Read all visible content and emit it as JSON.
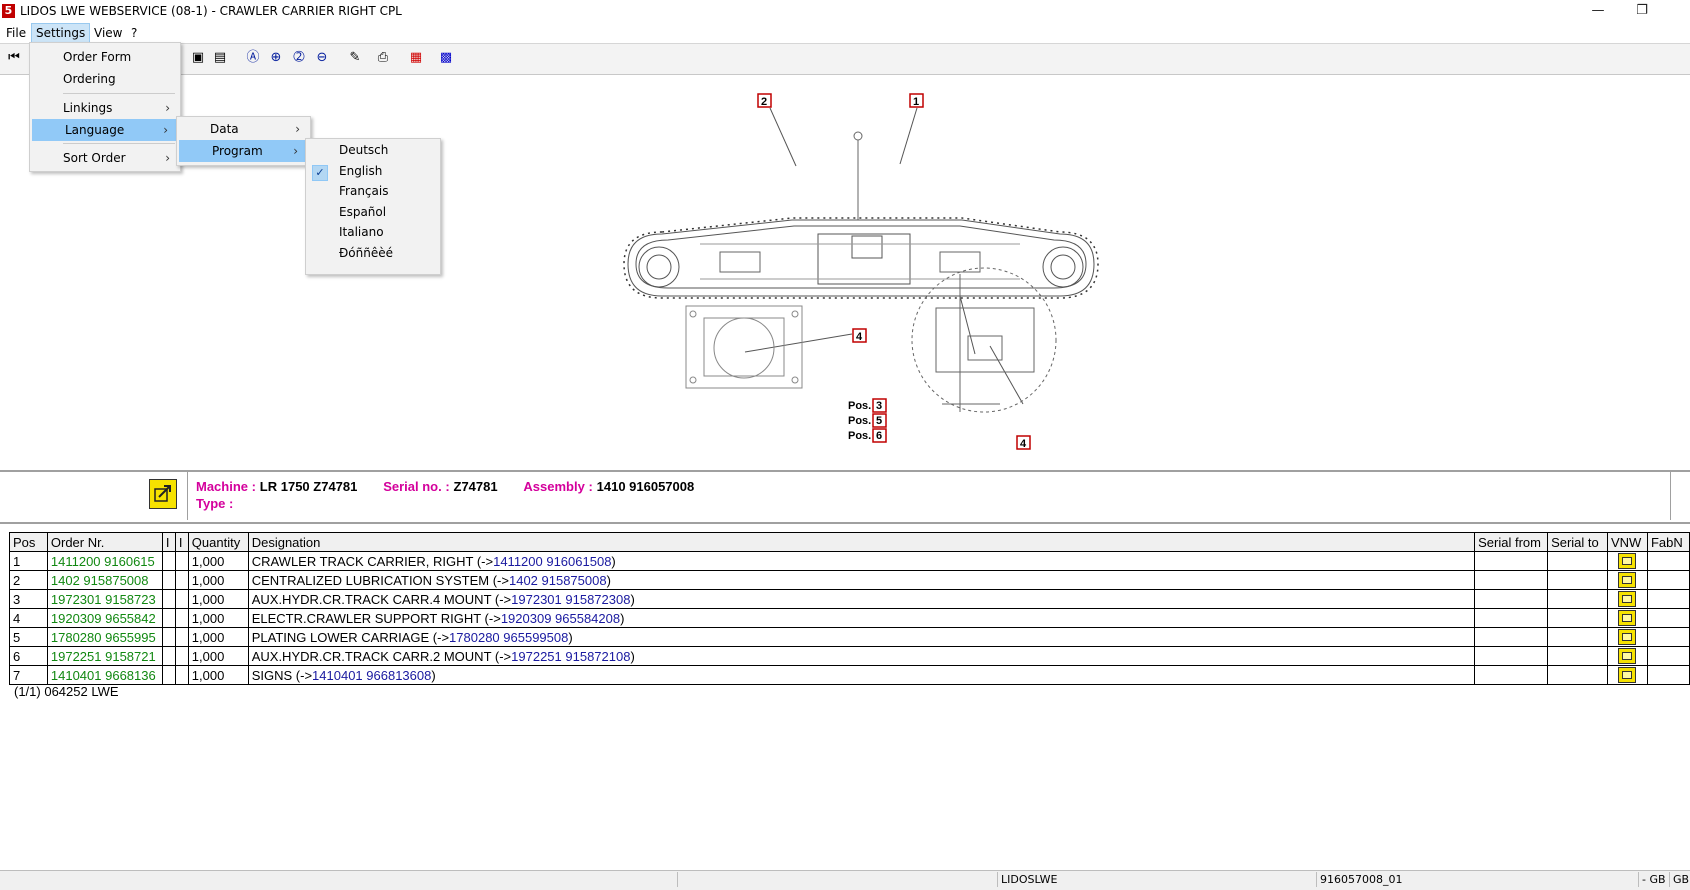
{
  "window": {
    "title": "LIDOS LWE WEBSERVICE (08-1) - CRAWLER CARRIER RIGHT CPL",
    "icon_letter": "5",
    "minimize_icon": "minimize-icon",
    "restore_icon": "restore-icon"
  },
  "menubar": {
    "file": "File",
    "settings": "Settings",
    "view": "View",
    "help": "?"
  },
  "settings_menu": {
    "order_form": "Order Form",
    "ordering": "Ordering",
    "linkings": "Linkings",
    "language": "Language",
    "sort_order": "Sort Order"
  },
  "language_menu": {
    "data": "Data",
    "program": "Program"
  },
  "program_menu": {
    "options": [
      "Deutsch",
      "English",
      "Français",
      "Español",
      "Italiano",
      "Ðóññêèé"
    ],
    "selected": "English"
  },
  "drawing": {
    "callouts": [
      "2",
      "1",
      "4",
      "4"
    ],
    "pos_label": "Pos.",
    "pos_refs": [
      "3",
      "5",
      "6"
    ]
  },
  "info": {
    "machine_label": "Machine :",
    "machine_value": "LR 1750 Z74781",
    "serial_label": "Serial no. :",
    "serial_value": "Z74781",
    "assembly_label": "Assembly :",
    "assembly_value": "1410 916057008",
    "type_label": "Type :"
  },
  "table": {
    "headers": [
      "Pos",
      "Order Nr.",
      "I",
      "I",
      "Quantity",
      "Designation",
      "Serial from",
      "Serial to",
      "VNW",
      "FabN"
    ],
    "rows": [
      {
        "pos": "1",
        "order": "1411200 9160615",
        "qty": "1,000",
        "desc": "CRAWLER TRACK CARRIER, RIGHT (->",
        "link": "1411200 916061508",
        "close": ")"
      },
      {
        "pos": "2",
        "order": "1402 915875008",
        "qty": "1,000",
        "desc": "CENTRALIZED LUBRICATION SYSTEM (->",
        "link": "1402 915875008",
        "close": ")"
      },
      {
        "pos": "3",
        "order": "1972301 9158723",
        "qty": "1,000",
        "desc": "AUX.HYDR.CR.TRACK CARR.4 MOUNT (->",
        "link": "1972301 915872308",
        "close": ")"
      },
      {
        "pos": "4",
        "order": "1920309 9655842",
        "qty": "1,000",
        "desc": "ELECTR.CRAWLER SUPPORT RIGHT (->",
        "link": "1920309 965584208",
        "close": ")"
      },
      {
        "pos": "5",
        "order": "1780280 9655995",
        "qty": "1,000",
        "desc": "PLATING LOWER CARRIAGE (->",
        "link": "1780280 965599508",
        "close": ")"
      },
      {
        "pos": "6",
        "order": "1972251 9158721",
        "qty": "1,000",
        "desc": "AUX.HYDR.CR.TRACK CARR.2 MOUNT (->",
        "link": "1972251 915872108",
        "close": ")"
      },
      {
        "pos": "7",
        "order": "1410401 9668136",
        "qty": "1,000",
        "desc": "SIGNS (->",
        "link": "1410401 966813608",
        "close": ")"
      }
    ],
    "footer": "(1/1) 064252 LWE"
  },
  "statusbar": {
    "user": "LIDOSLWE",
    "doc": "916057008_01",
    "flag1": "- GB",
    "flag2": "GB"
  },
  "colors": {
    "accent_menu": "#91c9f7",
    "order_green": "#118811",
    "link_blue": "#1a1aa0",
    "label_magenta": "#d4009c",
    "callout_red": "#c00000"
  }
}
